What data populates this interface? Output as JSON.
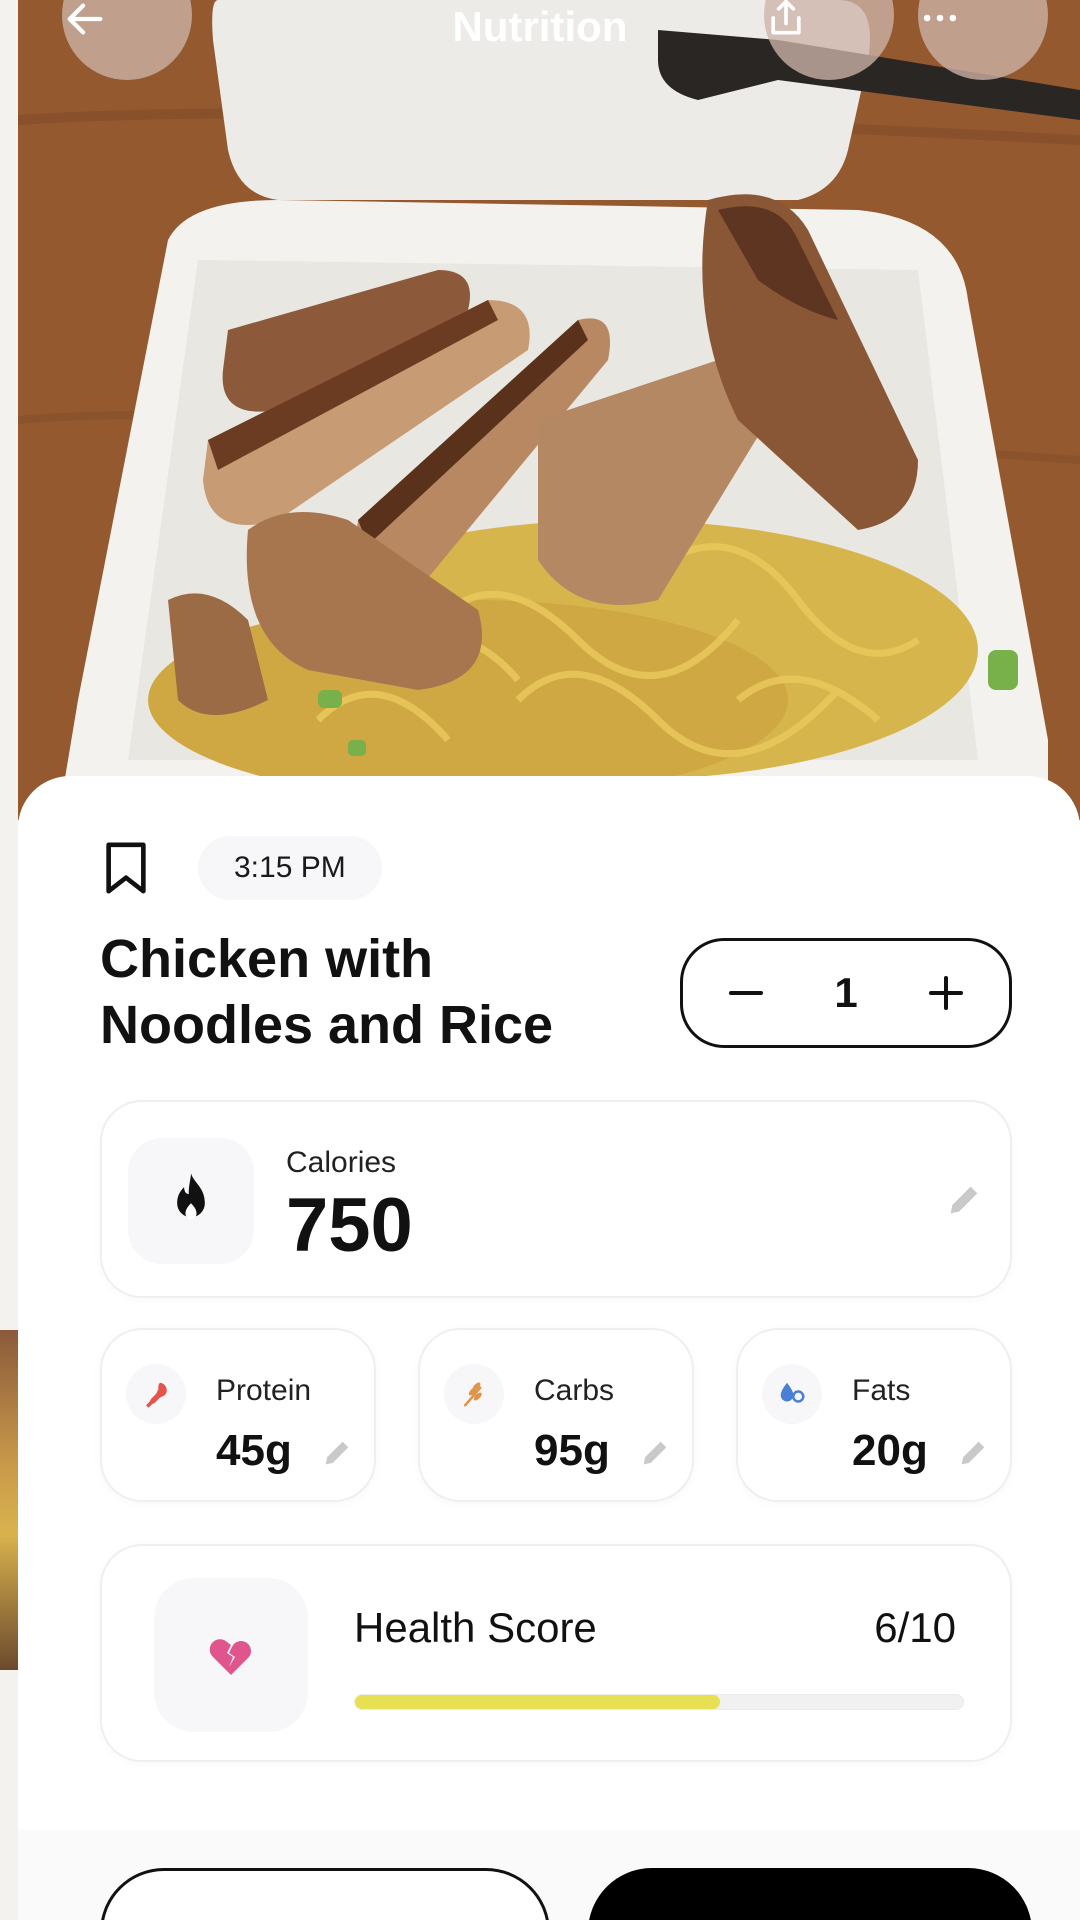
{
  "header": {
    "title": "Nutrition",
    "back_icon": "arrow-left-icon",
    "share_icon": "share-icon",
    "more_icon": "more-horizontal-icon"
  },
  "meal": {
    "time": "3:15 PM",
    "name_line1": "Chicken with",
    "name_line2": "Noodles and Rice",
    "quantity": "1"
  },
  "calories": {
    "label": "Calories",
    "value": "750"
  },
  "macros": [
    {
      "label": "Protein",
      "value": "45g",
      "icon": "drumstick-icon",
      "color": "#e5534b"
    },
    {
      "label": "Carbs",
      "value": "95g",
      "icon": "wheat-icon",
      "color": "#e0944a"
    },
    {
      "label": "Fats",
      "value": "20g",
      "icon": "oil-drop-icon",
      "color": "#4a7fd6"
    }
  ],
  "health": {
    "label": "Health Score",
    "value": "6/10",
    "score_fraction": 0.6,
    "bar_color": "#e6e052",
    "icon_color": "#e0558e"
  }
}
